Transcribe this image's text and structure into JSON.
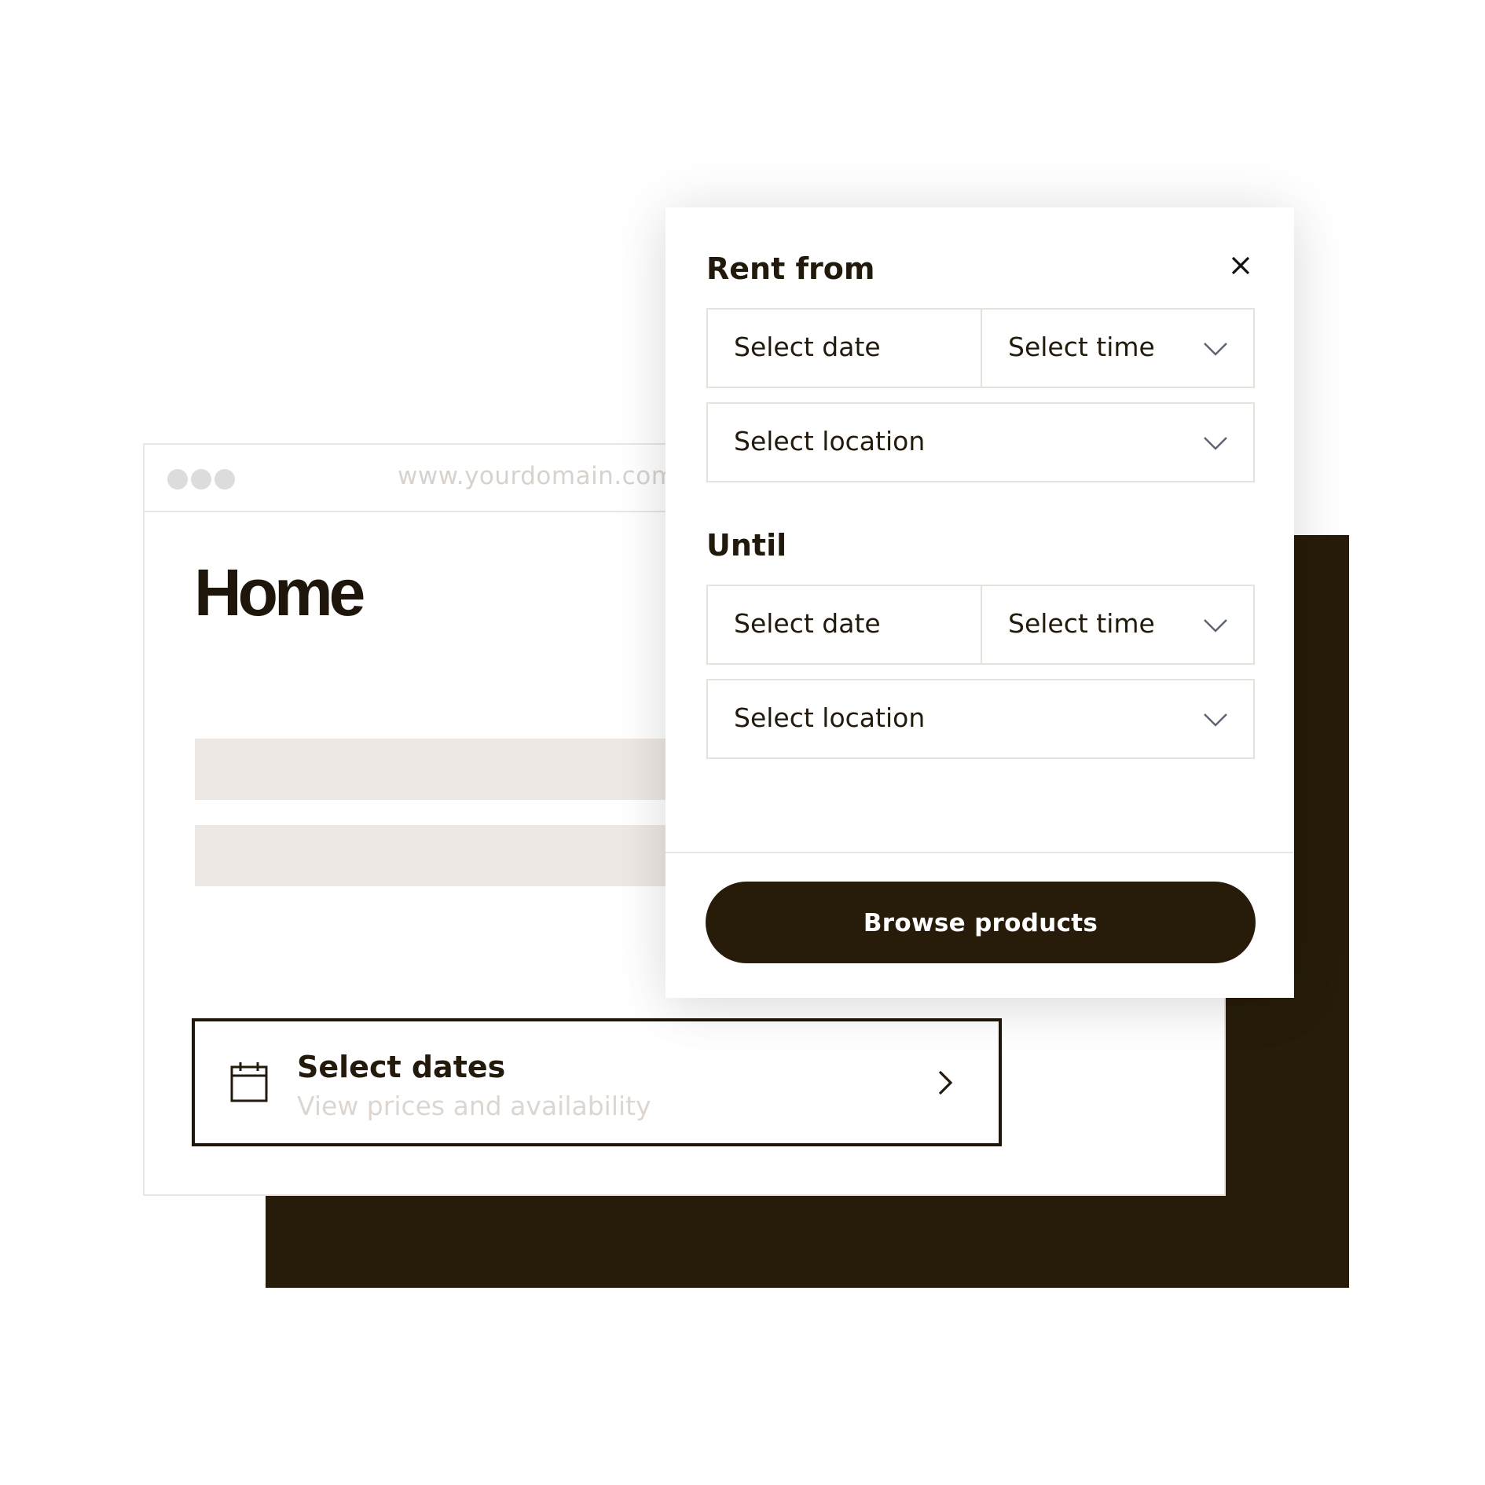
{
  "browser": {
    "url": "www.yourdomain.com",
    "page_title": "Home"
  },
  "date_widget": {
    "title": "Select dates",
    "subtitle": "View prices and availability",
    "icon": "calendar-icon",
    "arrow_icon": "chevron-right-icon"
  },
  "modal": {
    "from": {
      "heading": "Rent from",
      "date_placeholder": "Select date",
      "time_placeholder": "Select time",
      "location_placeholder": "Select location"
    },
    "until": {
      "heading": "Until",
      "date_placeholder": "Select date",
      "time_placeholder": "Select time",
      "location_placeholder": "Select location"
    },
    "close_icon": "close-icon",
    "browse_label": "Browse products"
  },
  "colors": {
    "brand_dark": "#271c0a",
    "border": "#e7e1dc",
    "placeholder_bar": "#ede8e3",
    "muted_text": "#ddd6d0"
  }
}
